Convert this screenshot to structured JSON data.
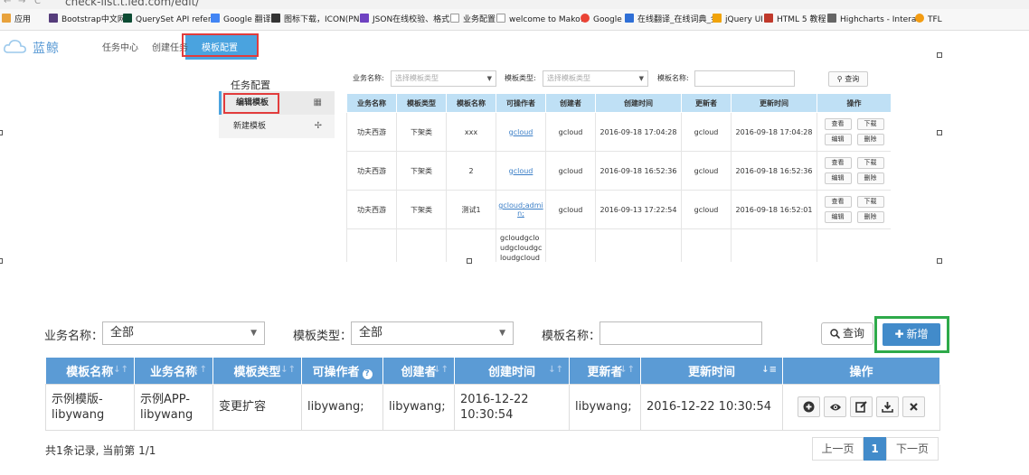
{
  "browser": {
    "url": "check-list.t.ied.com/edit/",
    "bookmarks": [
      {
        "label": "应用",
        "color": "#e8a23c"
      },
      {
        "label": "Bootstrap中文网",
        "color": "#563d7c"
      },
      {
        "label": "QuerySet API refere",
        "color": "#0c4b33"
      },
      {
        "label": "Google 翻译",
        "color": "#4285f4"
      },
      {
        "label": "图标下载，ICON(PN",
        "color": "#333333"
      },
      {
        "label": "JSON在线校验、格式",
        "color": "#6f42c1"
      },
      {
        "label": "业务配置",
        "color": "#999999"
      },
      {
        "label": "welcome to Mako!",
        "color": "#999999"
      },
      {
        "label": "Google",
        "color": "#ea4335"
      },
      {
        "label": "在线翻译_在线词典_金",
        "color": "#2f6fd6"
      },
      {
        "label": "jQuery UI",
        "color": "#f0a30a"
      },
      {
        "label": "HTML 5 教程",
        "color": "#c0392b"
      },
      {
        "label": "Highcharts - Interac",
        "color": "#666666"
      },
      {
        "label": "TFL",
        "color": "#f39c12"
      }
    ]
  },
  "old_ui": {
    "logo": "蓝鲸",
    "nav": [
      "任务中心",
      "创建任务",
      "模板配置"
    ],
    "sidebar_title": "任务配置",
    "sidebar_items": [
      "编辑模板",
      "新建模板"
    ],
    "filters": {
      "biz_label": "业务名称:",
      "biz_placeholder": "选择模板类型",
      "type_label": "模板类型:",
      "type_placeholder": "选择模板类型",
      "name_label": "模板名称:",
      "search": "查询"
    },
    "columns": [
      "业务名称",
      "模板类型",
      "模板名称",
      "可操作者",
      "创建者",
      "创建时间",
      "更新者",
      "更新时间",
      "操作"
    ],
    "rows": [
      {
        "biz": "功夫西游",
        "type": "下架类",
        "name": "xxx",
        "operators": "gcloud",
        "creator": "gcloud",
        "created": "2016-09-18 17:04:28",
        "updater": "gcloud",
        "updated": "2016-09-18 17:04:28"
      },
      {
        "biz": "功夫西游",
        "type": "下架类",
        "name": "2",
        "operators": "gcloud",
        "creator": "gcloud",
        "created": "2016-09-18 16:52:36",
        "updater": "gcloud",
        "updated": "2016-09-18 16:52:36"
      },
      {
        "biz": "功夫西游",
        "type": "下架类",
        "name": "测试1",
        "operators": "gcloud;admin;",
        "creator": "gcloud",
        "created": "2016-09-13 17:22:54",
        "updater": "gcloud",
        "updated": "2016-09-18 16:52:01"
      },
      {
        "biz": "",
        "type": "",
        "name": "",
        "operators": "gcloudgcloudgcloudgcloudgcloudgcloudgcl",
        "creator": "",
        "created": "",
        "updater": "",
        "updated": ""
      }
    ],
    "row_actions": [
      "查看",
      "下载",
      "编辑",
      "删除"
    ]
  },
  "filters": {
    "biz_label": "业务名称：",
    "biz_value": "全部",
    "type_label": "模板类型：",
    "type_value": "全部",
    "name_label": "模板名称：",
    "name_value": "",
    "search_label": "查询",
    "add_label": "新增"
  },
  "table": {
    "columns": [
      "模板名称",
      "业务名称",
      "模板类型",
      "可操作者",
      "创建者",
      "创建时间",
      "更新者",
      "更新时间",
      "操作"
    ],
    "rows": [
      {
        "template_name": "示例模版-libywang",
        "biz_name": "示例APP-libywang",
        "template_type": "变更扩容",
        "operators": "libywang;",
        "creator": "libywang;",
        "created": "2016-12-22 10:30:54",
        "updater": "libywang;",
        "updated": "2016-12-22 10:30:54",
        "actions": [
          "add-icon",
          "eye-icon",
          "edit-icon",
          "download-icon",
          "close-icon"
        ]
      }
    ]
  },
  "footer": {
    "summary": "共1条记录, 当前第 1/1",
    "prev": "上一页",
    "current_page": "1",
    "next": "下一页"
  },
  "colors": {
    "header_blue": "#5b9bd5",
    "primary": "#428bca",
    "highlight_green": "#2eaa4a",
    "highlight_red": "#e23c3c"
  }
}
